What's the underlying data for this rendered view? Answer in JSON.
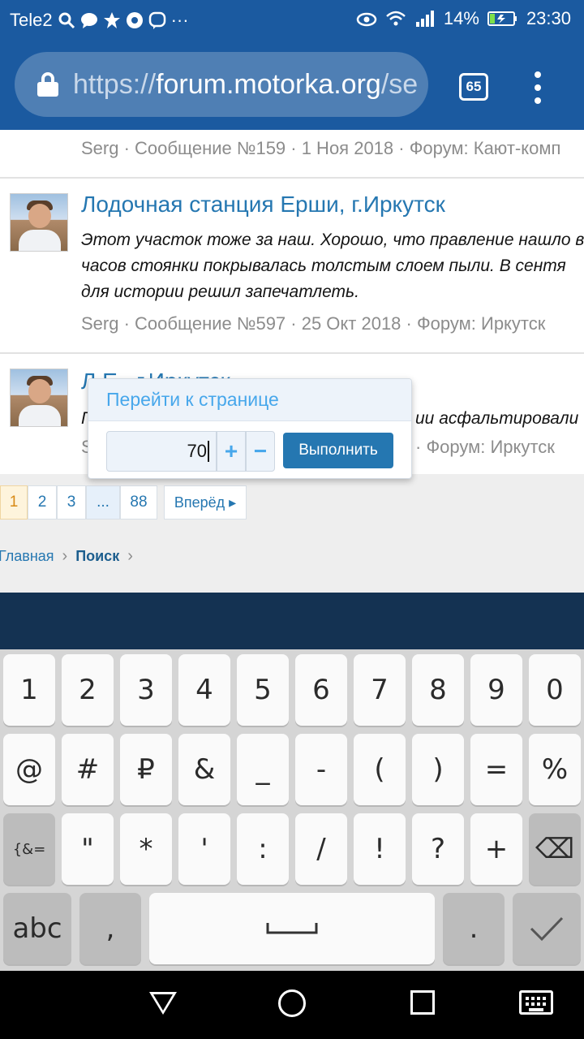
{
  "status_bar": {
    "carrier": "Tele2",
    "battery": "14%",
    "time": "23:30",
    "dots": "···"
  },
  "browser": {
    "url_scheme": "https://",
    "url_host": "forum.motorka.org",
    "url_rest": "/se",
    "tab_count": "65"
  },
  "results": [
    {
      "meta": "Serg · Сообщение №159 · 1 Ноя 2018 · Форум: Кают-комп"
    },
    {
      "title": "Лодочная станция Ерши, г.Иркутск",
      "text": [
        "Этот участок тоже за наш. Хорошо, что правление нашло в",
        "часов стоянки покрывалась толстым слоем пыли. В сентя",
        "для истории решил запечатлеть."
      ],
      "meta": "Serg · Сообщение №597 · 25 Окт 2018 · Форум: Иркутск"
    },
    {
      "title": "Л                              Е    , г.Иркутск",
      "text_visible": "ии асфальтировали",
      "text_left": "Г",
      "meta_left": "S",
      "meta_visible": "· Форум: Иркутск"
    }
  ],
  "goto_popup": {
    "title": "Перейти к странице",
    "value": "70",
    "plus": "+",
    "minus": "−",
    "submit": "Выполнить"
  },
  "pagination": {
    "pages": [
      "1",
      "2",
      "3",
      "...",
      "88"
    ],
    "current": "1",
    "next": "Вперёд ▸"
  },
  "breadcrumbs": {
    "home": "Главная",
    "search": "Поиск",
    "sep": "›"
  },
  "keyboard": {
    "row1": [
      "1",
      "2",
      "3",
      "4",
      "5",
      "6",
      "7",
      "8",
      "9",
      "0"
    ],
    "row2": [
      "@",
      "#",
      "₽",
      "&",
      "_",
      "-",
      "(",
      ")",
      "=",
      "%"
    ],
    "row3": [
      "{&=",
      "\"",
      "*",
      "'",
      ":",
      "/",
      "!",
      "?",
      "+",
      "⌫"
    ],
    "row4": [
      "abc",
      ",",
      "␣",
      ".",
      "✓"
    ]
  }
}
